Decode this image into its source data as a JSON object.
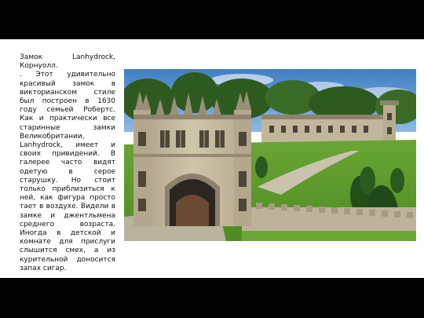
{
  "slide": {
    "title": "Замок Lanhydrock, Корнуолл.",
    "body": ". Этот удивительно красивый замок в викторианском стиле был построен в 1630 году семьей Робертс. Как и практически все старинные замки Великобритании, Lanhydrock, имеет и своих привидений. В галерее часто видят одетую в серое старушку. Но стоит только приблизиться к ней, как фигура просто тает в воздухе. Видели в замке и джентльмена среднего возраста. Иногда в детской и комнате для прислуги слышится смех, а из курительной доносится запах сигар."
  },
  "photo": {
    "subject": "Lanhydrock gatehouse and manor, Cornwall"
  },
  "colors": {
    "sky": "#4a86c8",
    "grass": "#5f9a2c",
    "stone": "#bfb49a",
    "page_bg": "#ffffff",
    "frame_bg": "#000000"
  }
}
